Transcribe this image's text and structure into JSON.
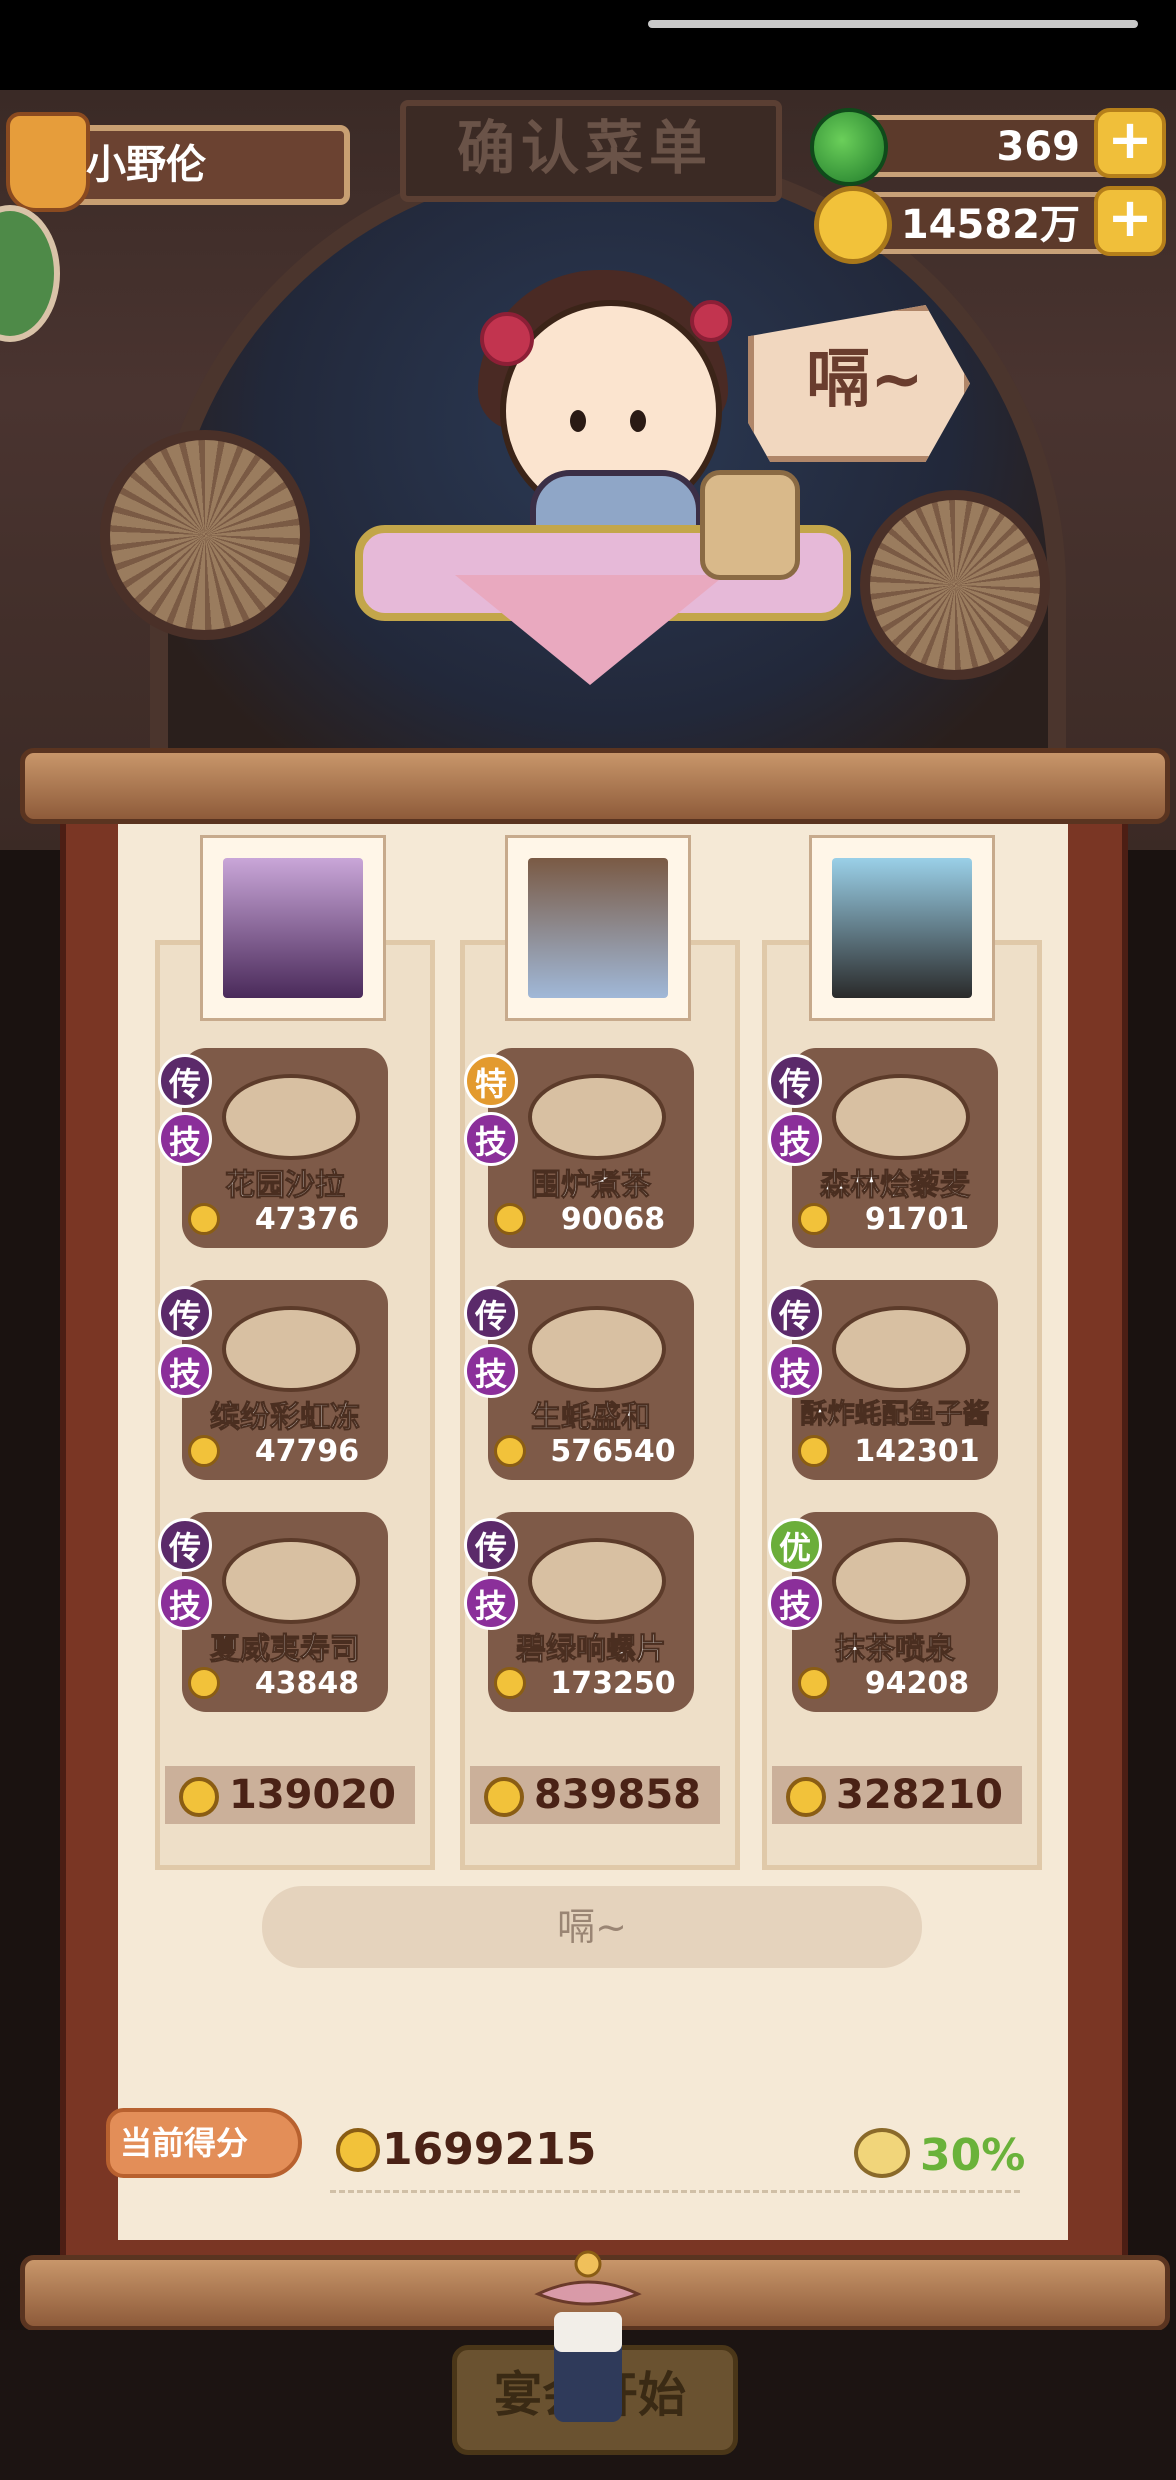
{
  "header": {
    "sign_title": "确认菜单",
    "player_name": "小野伦",
    "jade": "369",
    "coins": "14582万",
    "plus_label": "+"
  },
  "chef": {
    "speech": "嗝~"
  },
  "columns": [
    {
      "dishes": [
        {
          "grade": "传",
          "skill": "技",
          "name": "花园沙拉",
          "price": "47376"
        },
        {
          "grade": "传",
          "skill": "技",
          "name": "缤纷彩虹冻",
          "price": "47796"
        },
        {
          "grade": "传",
          "skill": "技",
          "name": "夏威夷寿司",
          "price": "43848"
        }
      ],
      "total": "139020"
    },
    {
      "dishes": [
        {
          "grade": "特",
          "skill": "技",
          "name": "围炉煮茶",
          "price": "90068"
        },
        {
          "grade": "传",
          "skill": "技",
          "name": "生蚝盛和",
          "price": "576540"
        },
        {
          "grade": "传",
          "skill": "技",
          "name": "碧绿响螺片",
          "price": "173250"
        }
      ],
      "total": "839858"
    },
    {
      "dishes": [
        {
          "grade": "传",
          "skill": "技",
          "name": "森林烩藜麦",
          "price": "91701"
        },
        {
          "grade": "传",
          "skill": "技",
          "name": "酥炸蚝配鱼子酱",
          "price": "142301"
        },
        {
          "grade": "优",
          "skill": "技",
          "name": "抹茶喷泉",
          "price": "94208"
        }
      ],
      "total": "328210"
    }
  ],
  "hum_button": "嗝~",
  "score": {
    "label": "当前得分",
    "value": "1699215",
    "bonus": "30%"
  },
  "start_button": "宴会开始",
  "colors": {
    "grade_legend": "#5b2a6a",
    "grade_special": "#e39a2e",
    "grade_excellent": "#6bae3a",
    "skill": "#8b2f9a"
  }
}
